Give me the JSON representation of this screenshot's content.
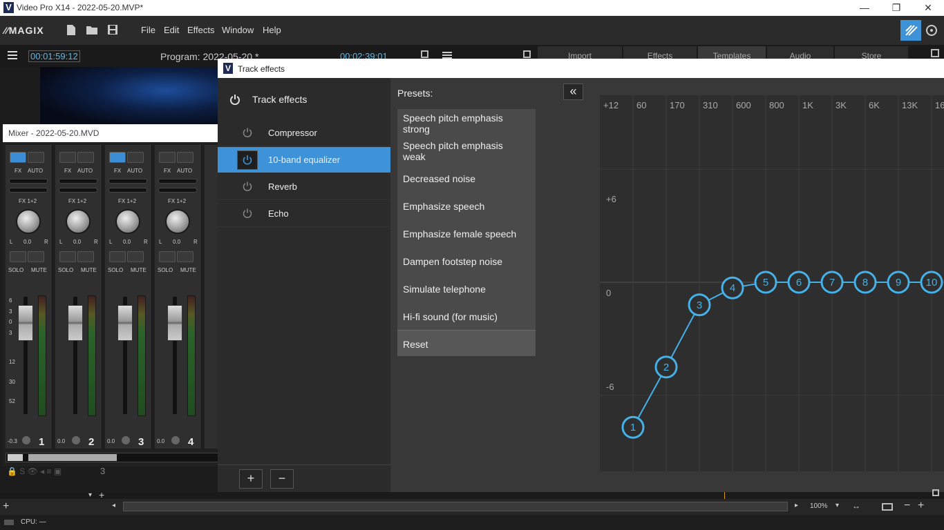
{
  "window": {
    "title": "Video Pro X14 - 2022-05-20.MVP*",
    "logo_letter": "V",
    "min": "—",
    "max": "❐",
    "close": "✕"
  },
  "toolbar": {
    "brand": "MAGIX",
    "menu": [
      "File",
      "Edit",
      "Effects",
      "Window",
      "Help"
    ]
  },
  "row2": {
    "timecode_left": "00:01:59:12",
    "program": "Program: 2022-05-20 *",
    "timecode_right": "00:02:39:01",
    "tabs": [
      "Import",
      "Effects",
      "Templates",
      "Audio",
      "Store"
    ]
  },
  "mixer": {
    "title": "Mixer - 2022-05-20.MVD",
    "fx": "FX",
    "auto": "AUTO",
    "fx12": "FX 1+2",
    "l": "L",
    "r": "R",
    "solo": "SOLO",
    "mute": "MUTE",
    "scale": [
      "6",
      "3",
      "0",
      "3",
      "12",
      "30",
      "52"
    ],
    "channels": [
      {
        "num": "1",
        "pan": "0.0",
        "level": "-0.3",
        "fx_on": true
      },
      {
        "num": "2",
        "pan": "0.0",
        "level": "0.0",
        "fx_on": false
      },
      {
        "num": "3",
        "pan": "0.0",
        "level": "0.0",
        "fx_on": true
      },
      {
        "num": "4",
        "pan": "0.0",
        "level": "0.0",
        "fx_on": false
      }
    ],
    "track_number": "3"
  },
  "dialog": {
    "title": "Track effects",
    "header": "Track effects",
    "effects": [
      {
        "label": "Compressor",
        "selected": false
      },
      {
        "label": "10-band equalizer",
        "selected": true
      },
      {
        "label": "Reverb",
        "selected": false
      },
      {
        "label": "Echo",
        "selected": false
      }
    ],
    "add": "+",
    "remove": "−",
    "presets_label": "Presets:",
    "presets": [
      "Speech pitch emphasis strong",
      "Speech pitch emphasis weak",
      "Decreased noise",
      "Emphasize speech",
      "Emphasize female speech",
      "Dampen footstep noise",
      "Simulate telephone",
      "Hi-fi sound (for music)"
    ],
    "reset": "Reset",
    "collapse": "«"
  },
  "equalizer": {
    "top_db": "+12",
    "frequencies": [
      "60",
      "170",
      "310",
      "600",
      "800",
      "1K",
      "3K",
      "6K",
      "13K",
      "16"
    ],
    "db_labels": [
      "+6",
      "0",
      "-6"
    ],
    "bands": [
      {
        "band": "1",
        "gain_db": -7.7
      },
      {
        "band": "2",
        "gain_db": -4.5
      },
      {
        "band": "3",
        "gain_db": -1.2
      },
      {
        "band": "4",
        "gain_db": -0.3
      },
      {
        "band": "5",
        "gain_db": 0
      },
      {
        "band": "6",
        "gain_db": 0
      },
      {
        "band": "7",
        "gain_db": 0
      },
      {
        "band": "8",
        "gain_db": 0
      },
      {
        "band": "9",
        "gain_db": 0
      },
      {
        "band": "10",
        "gain_db": 0
      }
    ],
    "accent": "#45b1e8"
  },
  "bottom": {
    "zoom": "100%",
    "cpu": "CPU: —"
  }
}
